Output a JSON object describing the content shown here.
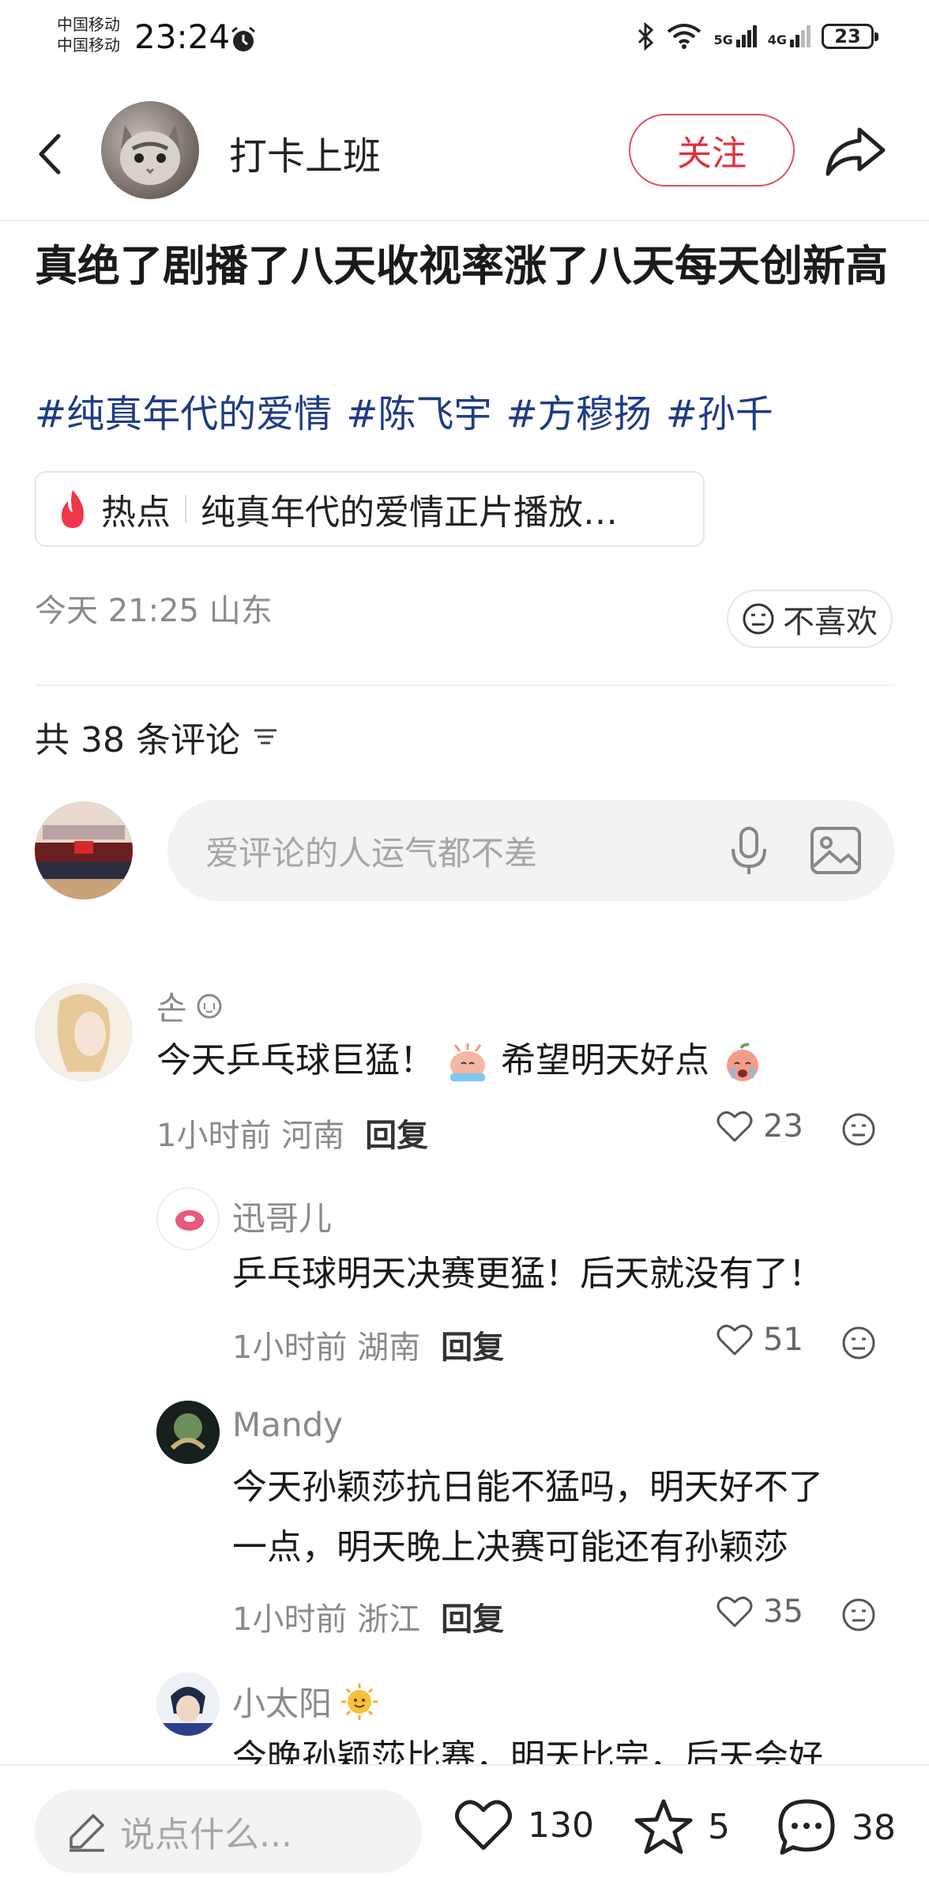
{
  "status_bar": {
    "carrier_1": "中国移动",
    "carrier_2": "中国移动",
    "time": "23:24",
    "signal_1": "5G",
    "signal_2": "4G",
    "battery": "23"
  },
  "header": {
    "author_name": "打卡上班",
    "follow_label": "关注"
  },
  "post": {
    "title": "真绝了剧播了八天收视率涨了八天每天创新高",
    "hashtags": [
      "#纯真年代的爱情",
      "#陈飞宇",
      "#方穆扬",
      "#孙千"
    ],
    "hot_tag": "热点",
    "hot_text": "纯真年代的爱情正片播放…",
    "meta": "今天 21:25 山东",
    "dislike_label": "不喜欢"
  },
  "comments_header": {
    "count_text": "共 38 条评论"
  },
  "comment_input": {
    "placeholder": "爱评论的人运气都不差"
  },
  "comments": [
    {
      "name": "손",
      "text_a": "今天乒乓球巨猛！",
      "text_b": "希望明天好点",
      "time": "1小时前",
      "location": "河南",
      "reply": "回复",
      "likes": "23"
    },
    {
      "name": "迅哥儿",
      "text": "乒乓球明天决赛更猛！后天就没有了！",
      "time": "1小时前",
      "location": "湖南",
      "reply": "回复",
      "likes": "51"
    },
    {
      "name": "Mandy",
      "text_line1": "今天孙颖莎抗日能不猛吗，明天好不了",
      "text_line2": "一点，明天晚上决赛可能还有孙颖莎",
      "time": "1小时前",
      "location": "浙江",
      "reply": "回复",
      "likes": "35"
    },
    {
      "name": "小太阳",
      "text": "今晚孙颖莎比赛，明天比完，后天会好"
    }
  ],
  "bottom_bar": {
    "say_placeholder": "说点什么...",
    "likes": "130",
    "favorites": "5",
    "comments": "38"
  },
  "colors": {
    "accent_red": "#e0303f",
    "hashtag_blue": "#1f3c84",
    "meta_gray": "#8a8a8a"
  }
}
